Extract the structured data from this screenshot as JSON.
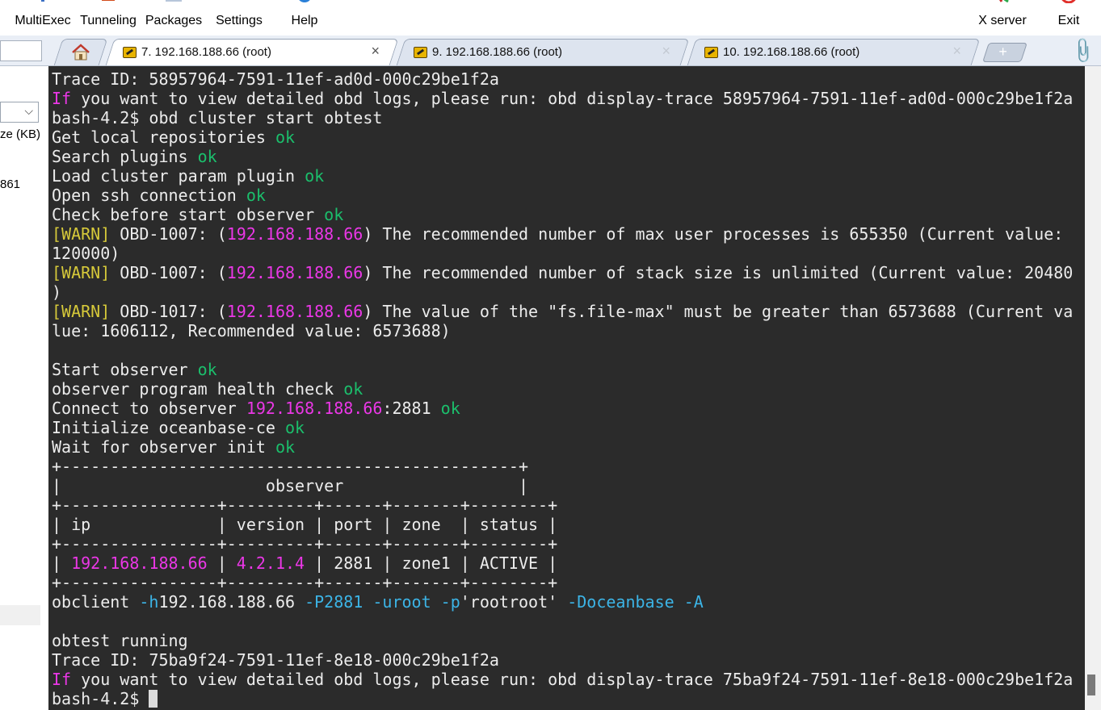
{
  "toolbar": {
    "multiexec": "MultiExec",
    "tunneling": "Tunneling",
    "packages": "Packages",
    "settings": "Settings",
    "help": "Help",
    "xserver": "X server",
    "exit": "Exit"
  },
  "tabs": [
    {
      "label": "7. 192.168.188.66 (root)",
      "active": true
    },
    {
      "label": "9. 192.168.188.66 (root)",
      "active": false
    },
    {
      "label": "10. 192.168.188.66 (root)",
      "active": false
    }
  ],
  "tab_close_glyph": "×",
  "new_tab_glyph": "+",
  "sidebar": {
    "size_header": "ze (KB)",
    "size_value": "861",
    "select_arrow": "⌵"
  },
  "terminal": {
    "trace1_label": "Trace ID: ",
    "trace1_id": "58957964-7591-11ef-ad0d-000c29be1f2a",
    "if_word": "If",
    "view_logs_text": " you want to view detailed obd logs, please run: obd display-trace ",
    "cmd_prompt": "bash-4.2$ ",
    "cmd_start": "obd cluster start obtest",
    "get_repos": "Get local repositories ",
    "search_plugins": "Search plugins ",
    "load_param": "Load cluster param plugin ",
    "open_ssh": "Open ssh connection ",
    "check_before": "Check before start observer ",
    "ok": "ok",
    "warn_tag": "[WARN]",
    "warn1_code": " OBD-1007: (",
    "ip": "192.168.188.66",
    "warn1_msg": ") The recommended number of max user processes is 655350 (Current value:",
    "warn1_cont": "120000)",
    "warn2_msg": ") The recommended number of stack size is unlimited (Current value: 20480",
    "warn2_cont": ")",
    "warn3_code": " OBD-1017: (",
    "warn3_msg": ") The value of the \"fs.file-max\" must be greater than 6573688 (Current va",
    "warn3_cont": "lue: 1606112, Recommended value: 6573688)",
    "start_observer": "Start observer ",
    "health_check": "observer program health check ",
    "connect": "Connect to observer ",
    "connect_port": ":2881 ",
    "init": "Initialize oceanbase-ce ",
    "wait_init": "Wait for observer init ",
    "table": {
      "border_top": "+-----------------------------------------------+",
      "title_row": "|                     observer                  |",
      "border_mid": "+----------------+---------+------+-------+--------+",
      "header_row": "| ip             | version | port | zone  | status |",
      "row_pipe_start": "| ",
      "row_ip": "192.168.188.66",
      "row_sep1": " | ",
      "row_version": "4.2.1.4",
      "row_rest": " | 2881 | zone1 | ACTIVE |"
    },
    "obclient_cmd": "obclient ",
    "obclient_h": "-h",
    "obclient_host": "192.168.188.66 ",
    "obclient_p": "-P2881 -uroot -p",
    "obclient_pwd": "'rootroot' ",
    "obclient_db": "-Doceanbase -A",
    "running": "obtest running",
    "trace2_label": "Trace ID: ",
    "trace2_id": "75ba9f24-7591-11ef-8e18-000c29be1f2a",
    "final_prompt": "bash-4.2$ "
  }
}
